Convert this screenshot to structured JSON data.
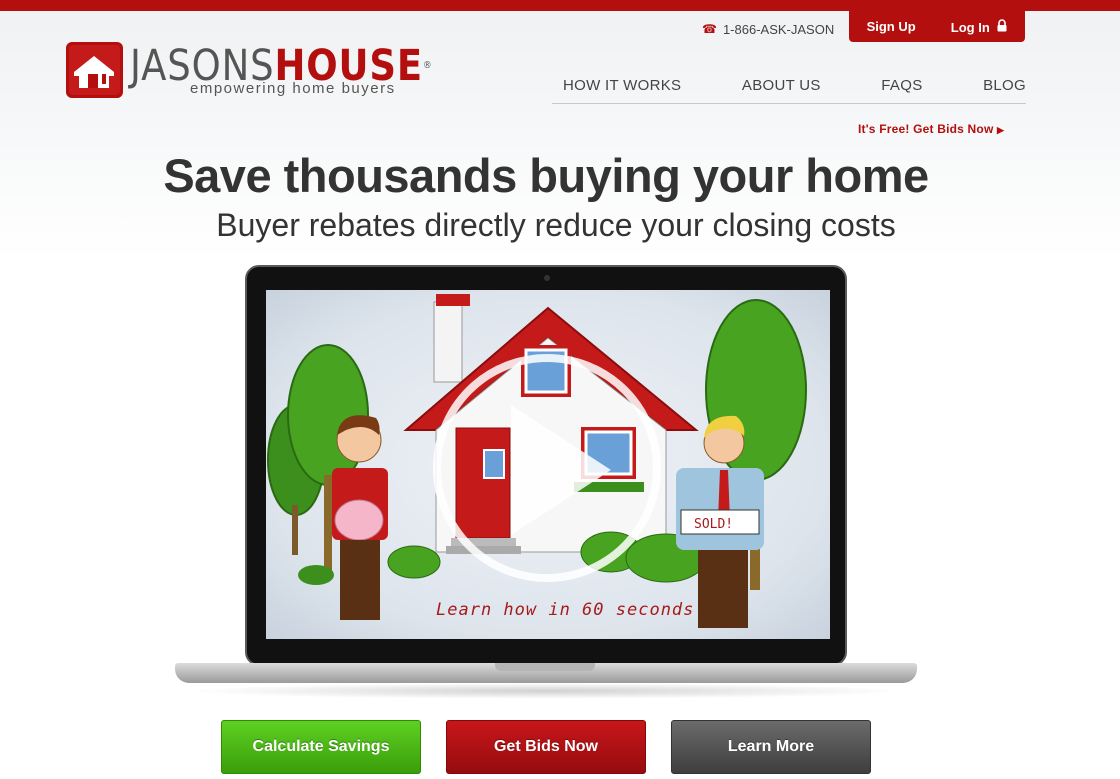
{
  "header": {
    "phone": "1-866-ASK-JASON",
    "sign_up": "Sign Up",
    "log_in": "Log In",
    "logo": {
      "jasons": "JASONS",
      "house": "HOUSE",
      "registered": "®",
      "tagline": "empowering home buyers"
    },
    "nav": [
      "HOW IT WORKS",
      "ABOUT US",
      "FAQS",
      "BLOG"
    ],
    "cta_link": "It's Free! Get Bids Now"
  },
  "hero": {
    "headline": "Save thousands buying your home",
    "subhead": "Buyer rebates directly reduce your closing costs"
  },
  "video": {
    "caption": "Learn how in 60 seconds",
    "sign_text": "SOLD!"
  },
  "actions": {
    "calculate": "Calculate Savings",
    "get_bids": "Get Bids Now",
    "learn_more": "Learn More"
  },
  "colors": {
    "brand_red": "#b30f0f",
    "green": "#3a9e0a",
    "gray": "#4a4a4a"
  }
}
